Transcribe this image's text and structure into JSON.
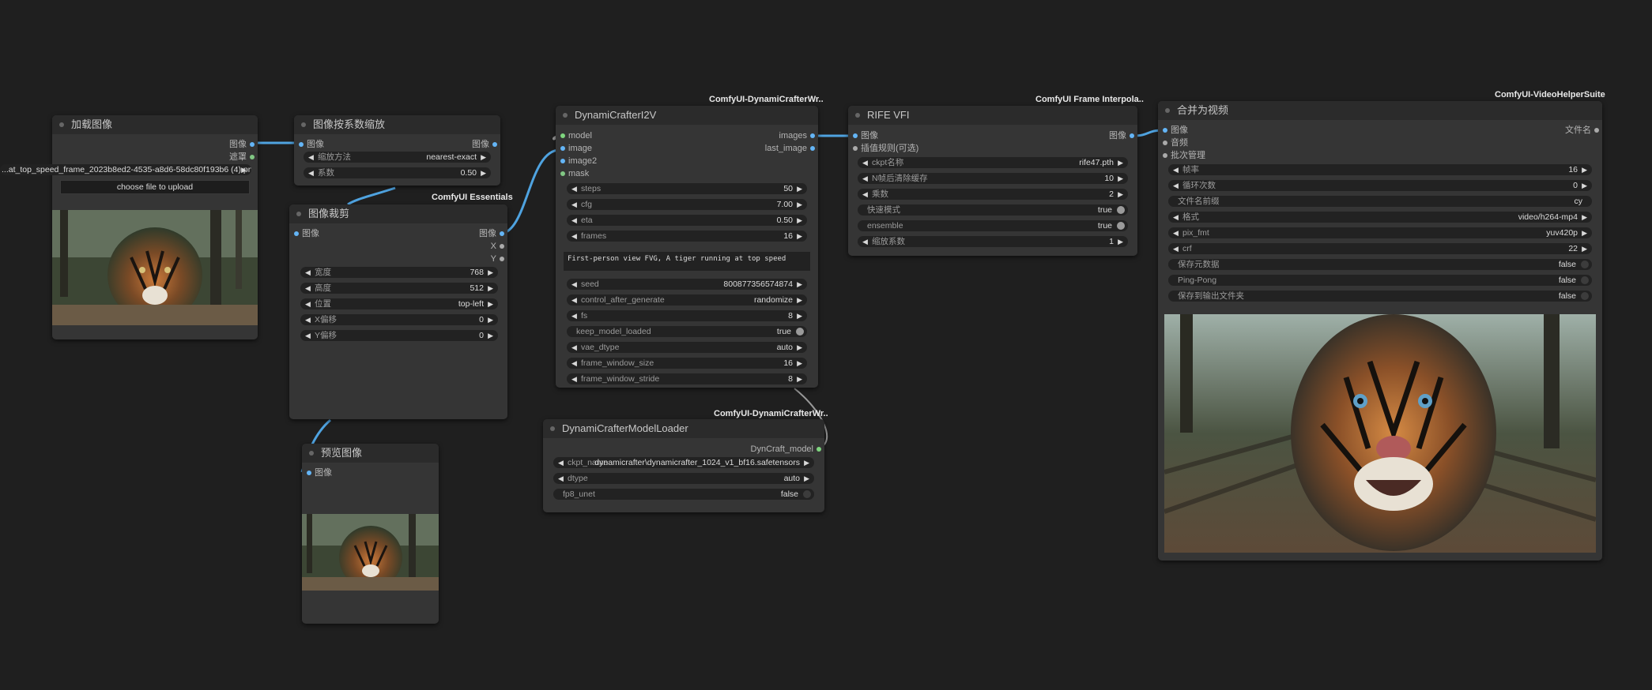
{
  "colors": {
    "background": "#1f1f1f",
    "node": "#353535",
    "title": "#2b2b2b",
    "wire_image": "#4fa3e0",
    "port_image": "#64b5f6",
    "port_model": "#7fd67f",
    "port_mask": "#81c784"
  },
  "load_image": {
    "title": "加载图像",
    "out_image": "图像",
    "out_mask": "遮罩",
    "filename": "...at_top_speed_frame_2023b8ed2-4535-a8d6-58dc80f193b6 (4).png",
    "upload_label": "choose file to upload"
  },
  "scale_by": {
    "title": "图像按系数缩放",
    "in_image": "图像",
    "out_image": "图像",
    "method_label": "缩放方法",
    "method_value": "nearest-exact",
    "factor_label": "系数",
    "factor_value": "0.50"
  },
  "crop": {
    "badge": "ComfyUI Essentials",
    "title": "图像裁剪",
    "in_image": "图像",
    "out_image": "图像",
    "out_x": "X",
    "out_y": "Y",
    "width_label": "宽度",
    "width_value": "768",
    "height_label": "高度",
    "height_value": "512",
    "pos_label": "位置",
    "pos_value": "top-left",
    "xoff_label": "X偏移",
    "xoff_value": "0",
    "yoff_label": "Y偏移",
    "yoff_value": "0"
  },
  "preview": {
    "title": "预览图像",
    "in_image": "图像"
  },
  "i2v": {
    "badge": "ComfyUI-DynamiCrafterWr..",
    "title": "DynamiCrafterI2V",
    "in_model": "model",
    "in_image": "image",
    "in_image2": "image2",
    "in_mask": "mask",
    "out_images": "images",
    "out_last": "last_image",
    "steps_label": "steps",
    "steps_value": "50",
    "cfg_label": "cfg",
    "cfg_value": "7.00",
    "eta_label": "eta",
    "eta_value": "0.50",
    "frames_label": "frames",
    "frames_value": "16",
    "prompt": "First-person view FVG, A tiger running at top speed",
    "seed_label": "seed",
    "seed_value": "800877356574874",
    "cag_label": "control_after_generate",
    "cag_value": "randomize",
    "fs_label": "fs",
    "fs_value": "8",
    "kml_label": "keep_model_loaded",
    "kml_value": "true",
    "vae_label": "vae_dtype",
    "vae_value": "auto",
    "fws_label": "frame_window_size",
    "fws_value": "16",
    "fwst_label": "frame_window_stride",
    "fwst_value": "8"
  },
  "loader": {
    "badge": "ComfyUI-DynamiCrafterWr..",
    "title": "DynamiCrafterModelLoader",
    "out_model": "DynCraft_model",
    "ckpt_label": "ckpt_name",
    "ckpt_value": "dynamicrafter\\dynamicrafter_1024_v1_bf16.safetensors",
    "dtype_label": "dtype",
    "dtype_value": "auto",
    "fp8_label": "fp8_unet",
    "fp8_value": "false"
  },
  "rife": {
    "badge": "ComfyUI Frame Interpola..",
    "title": "RIFE VFI",
    "in_image": "图像",
    "in_opt": "插值规则(可选)",
    "out_image": "图像",
    "ckpt_label": "ckpt名称",
    "ckpt_value": "rife47.pth",
    "clear_label": "N帧后清除缓存",
    "clear_value": "10",
    "mult_label": "乘数",
    "mult_value": "2",
    "fast_label": "快速模式",
    "fast_value": "true",
    "ens_label": "ensemble",
    "ens_value": "true",
    "scale_label": "缩放系数",
    "scale_value": "1"
  },
  "combine": {
    "badge": "ComfyUI-VideoHelperSuite",
    "title": "合并为视频",
    "in_image": "图像",
    "in_audio": "音频",
    "in_batch": "批次管理",
    "out_filenames": "文件名",
    "fps_label": "帧率",
    "fps_value": "16",
    "loop_label": "循环次数",
    "loop_value": "0",
    "prefix_label": "文件名前缀",
    "prefix_value": "cy",
    "fmt_label": "格式",
    "fmt_value": "video/h264-mp4",
    "pix_label": "pix_fmt",
    "pix_value": "yuv420p",
    "crf_label": "crf",
    "crf_value": "22",
    "meta_label": "保存元数据",
    "meta_value": "false",
    "pp_label": "Ping-Pong",
    "pp_value": "false",
    "save_label": "保存到输出文件夹",
    "save_value": "false"
  }
}
